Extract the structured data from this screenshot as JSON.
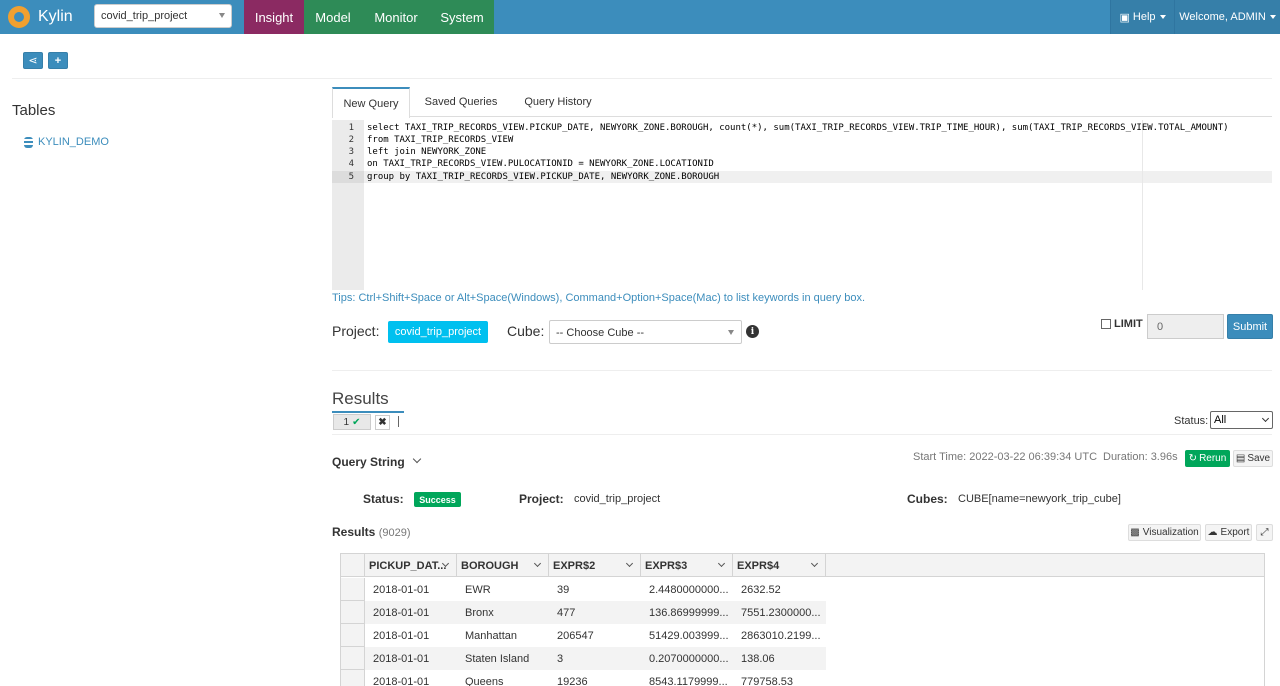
{
  "nav": {
    "brand": "Kylin",
    "project_select": "covid_trip_project",
    "tabs": [
      "Insight",
      "Model",
      "Monitor",
      "System"
    ],
    "help": "Help",
    "welcome": "Welcome, ADMIN",
    "accent_color": "#3c8dbc",
    "active_tab_color": "#8b2a62"
  },
  "sidebar": {
    "title": "Tables",
    "items": [
      "KYLIN_DEMO"
    ]
  },
  "query_tabs": [
    "New Query",
    "Saved Queries",
    "Query History"
  ],
  "editor": {
    "line_numbers": [
      "1",
      "2",
      "3",
      "4",
      "5"
    ],
    "lines": [
      "select TAXI_TRIP_RECORDS_VIEW.PICKUP_DATE, NEWYORK_ZONE.BOROUGH, count(*), sum(TAXI_TRIP_RECORDS_VIEW.TRIP_TIME_HOUR), sum(TAXI_TRIP_RECORDS_VIEW.TOTAL_AMOUNT)",
      "from TAXI_TRIP_RECORDS_VIEW",
      "left join NEWYORK_ZONE",
      "on TAXI_TRIP_RECORDS_VIEW.PULOCATIONID = NEWYORK_ZONE.LOCATIONID",
      "group by TAXI_TRIP_RECORDS_VIEW.PICKUP_DATE, NEWYORK_ZONE.BOROUGH"
    ],
    "tips": "Tips: Ctrl+Shift+Space or Alt+Space(Windows), Command+Option+Space(Mac) to list keywords in query box."
  },
  "query_form": {
    "project_label": "Project:",
    "project_value": "covid_trip_project",
    "cube_label": "Cube:",
    "cube_placeholder": "-- Choose Cube --",
    "limit_label": "LIMIT",
    "limit_value": "0",
    "submit": "Submit"
  },
  "results": {
    "title": "Results",
    "tab_label": "1",
    "status_label": "Status:",
    "status_value": "All",
    "query_string_label": "Query String",
    "start_time": "Start Time: 2022-03-22 06:39:34 UTC",
    "duration": "Duration: 3.96s",
    "rerun": "Rerun",
    "save": "Save",
    "status_field_label": "Status:",
    "status_badge": "Success",
    "project_field_label": "Project:",
    "project_field_value": "covid_trip_project",
    "cubes_label": "Cubes:",
    "cubes_value": "CUBE[name=newyork_trip_cube]",
    "results_label": "Results",
    "results_count": "(9029)",
    "visualization": "Visualization",
    "export": "Export"
  },
  "grid": {
    "columns": [
      "PICKUP_DAT...",
      "BOROUGH",
      "EXPR$2",
      "EXPR$3",
      "EXPR$4"
    ],
    "rows": [
      [
        "2018-01-01",
        "EWR",
        "39",
        "2.4480000000...",
        "2632.52"
      ],
      [
        "2018-01-01",
        "Bronx",
        "477",
        "136.86999999...",
        "7551.2300000..."
      ],
      [
        "2018-01-01",
        "Manhattan",
        "206547",
        "51429.003999...",
        "2863010.2199..."
      ],
      [
        "2018-01-01",
        "Staten Island",
        "3",
        "0.2070000000...",
        "138.06"
      ],
      [
        "2018-01-01",
        "Queens",
        "19236",
        "8543.1179999...",
        "779758.53"
      ]
    ]
  }
}
